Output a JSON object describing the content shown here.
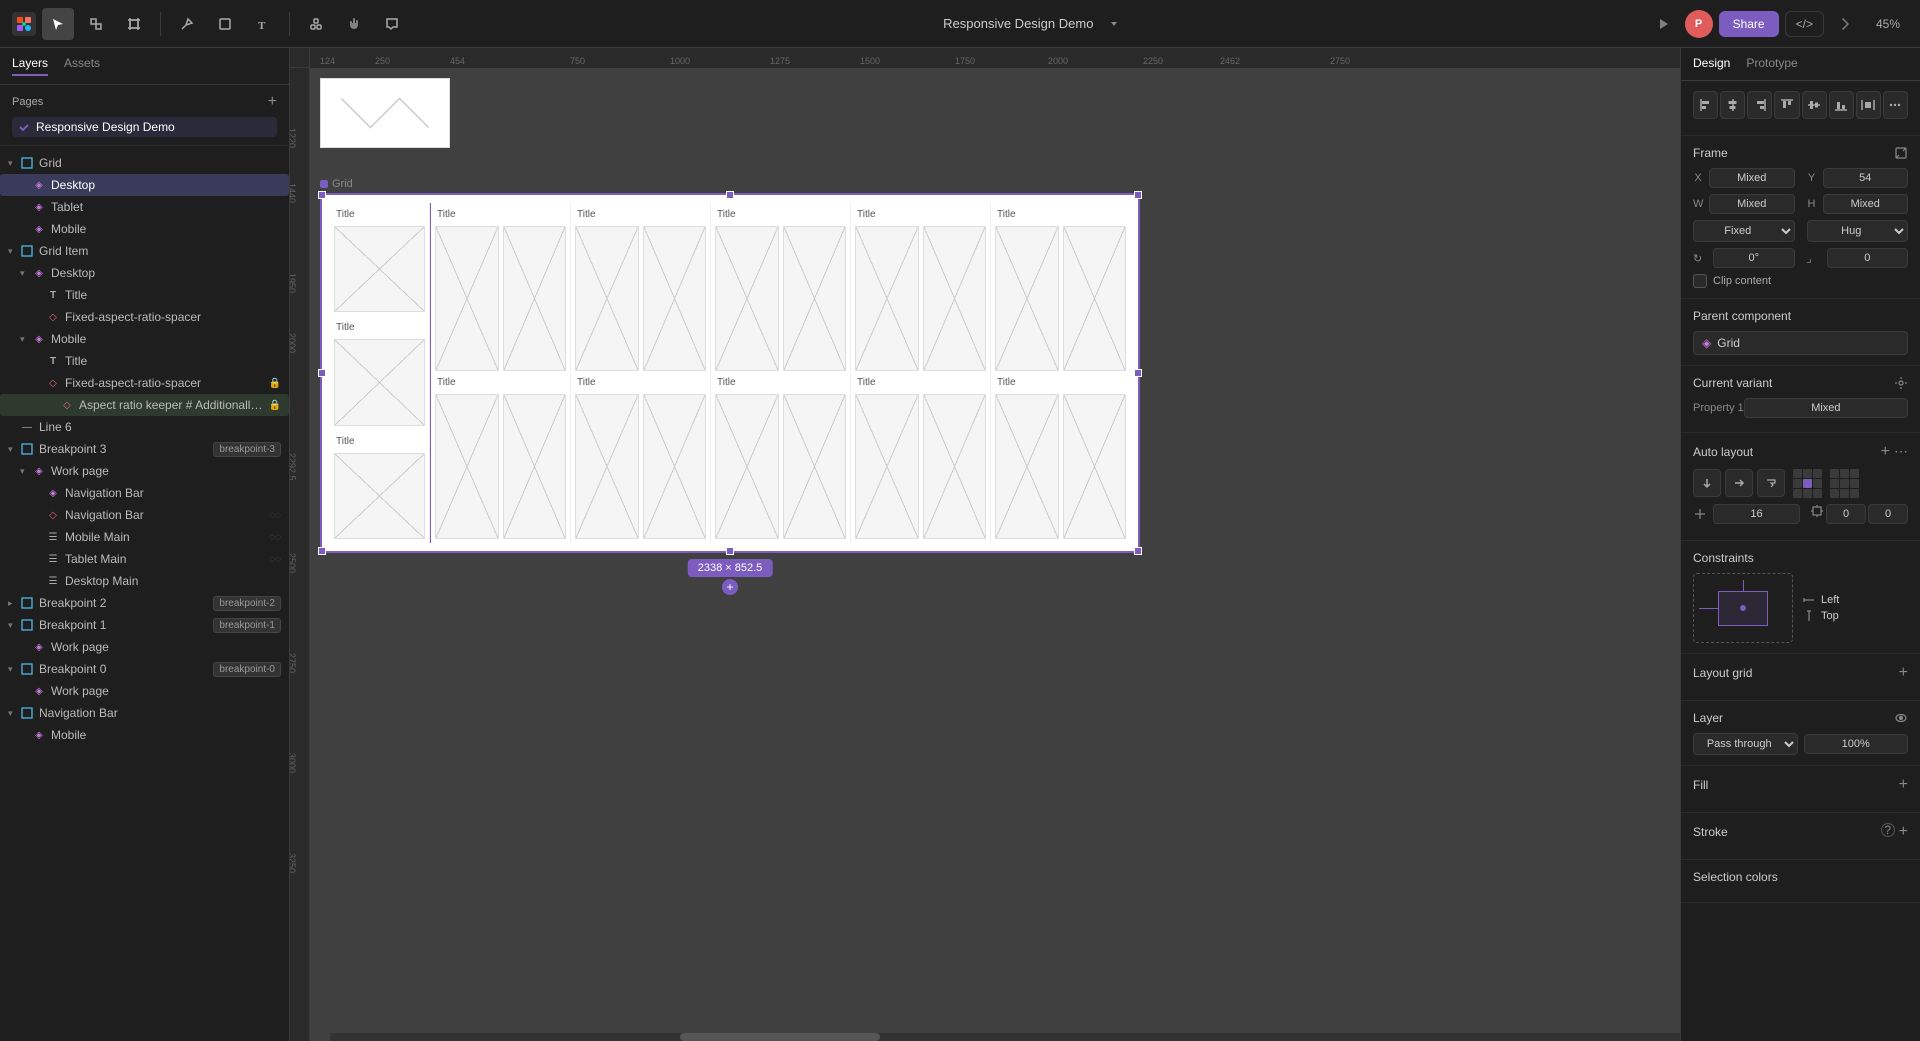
{
  "toolbar": {
    "title": "Responsive Design Demo",
    "share_label": "Share",
    "zoom_label": "45%",
    "code_label": "</>"
  },
  "sidebar": {
    "tabs": [
      {
        "id": "layers",
        "label": "Layers"
      },
      {
        "id": "assets",
        "label": "Assets"
      }
    ],
    "active_tab": "layers",
    "pages": {
      "header": "Pages",
      "items": [
        {
          "id": "responsive",
          "label": "Responsive Design Demo",
          "active": true
        }
      ]
    },
    "layers": [
      {
        "id": "grid",
        "name": "Grid",
        "icon": "frame",
        "indent": 0,
        "expanded": true
      },
      {
        "id": "desktop",
        "name": "Desktop",
        "icon": "component",
        "indent": 1,
        "selected": true
      },
      {
        "id": "tablet",
        "name": "Tablet",
        "icon": "component",
        "indent": 1
      },
      {
        "id": "mobile",
        "name": "Mobile",
        "icon": "component",
        "indent": 1
      },
      {
        "id": "grid-item",
        "name": "Grid Item",
        "icon": "frame",
        "indent": 0,
        "expanded": true
      },
      {
        "id": "desktop-gi",
        "name": "Desktop",
        "icon": "component",
        "indent": 1,
        "expanded": true
      },
      {
        "id": "title-1",
        "name": "Title",
        "icon": "text",
        "indent": 2
      },
      {
        "id": "fixed-aspect-1",
        "name": "Fixed-aspect-ratio-spacer",
        "icon": "shape",
        "indent": 2
      },
      {
        "id": "mobile-gi",
        "name": "Mobile",
        "icon": "component",
        "indent": 1,
        "expanded": true
      },
      {
        "id": "title-2",
        "name": "Title",
        "icon": "text",
        "indent": 2
      },
      {
        "id": "fixed-aspect-2",
        "name": "Fixed-aspect-ratio-spacer",
        "icon": "shape",
        "indent": 2
      },
      {
        "id": "line-6",
        "name": "Line 6",
        "icon": "line",
        "indent": 0
      },
      {
        "id": "breakpoint-3",
        "name": "Breakpoint 3",
        "icon": "frame",
        "indent": 0,
        "badge": "breakpoint-3",
        "expanded": true
      },
      {
        "id": "work-page-1",
        "name": "Work page",
        "icon": "component",
        "indent": 1,
        "expanded": true
      },
      {
        "id": "nav-bar-1",
        "name": "Navigation Bar",
        "icon": "component",
        "indent": 2
      },
      {
        "id": "nav-bar-2",
        "name": "Navigation Bar",
        "icon": "shape",
        "indent": 2,
        "vis_icon": true
      },
      {
        "id": "mobile-main",
        "name": "Mobile Main",
        "icon": "group",
        "indent": 2,
        "vis_icon": true
      },
      {
        "id": "tablet-main",
        "name": "Tablet Main",
        "icon": "group",
        "indent": 2,
        "vis_icon": true
      },
      {
        "id": "desktop-main",
        "name": "Desktop Main",
        "icon": "group",
        "indent": 2
      },
      {
        "id": "breakpoint-2",
        "name": "Breakpoint 2",
        "icon": "frame",
        "indent": 0,
        "badge": "breakpoint-2"
      },
      {
        "id": "breakpoint-1",
        "name": "Breakpoint 1",
        "icon": "frame",
        "indent": 0,
        "badge": "breakpoint-1",
        "expanded": true
      },
      {
        "id": "work-page-2",
        "name": "Work page",
        "icon": "component",
        "indent": 1
      },
      {
        "id": "breakpoint-0",
        "name": "Breakpoint 0",
        "icon": "frame",
        "indent": 0,
        "badge": "breakpoint-0",
        "expanded": true
      },
      {
        "id": "work-page-3",
        "name": "Work page",
        "icon": "component",
        "indent": 1
      },
      {
        "id": "nav-bar-3",
        "name": "Navigation Bar",
        "icon": "frame",
        "indent": 0,
        "expanded": true
      },
      {
        "id": "mobile-nav",
        "name": "Mobile",
        "icon": "component",
        "indent": 1
      }
    ]
  },
  "canvas": {
    "rulers": {
      "h_marks": [
        "124",
        "250",
        "454",
        "750",
        "1000",
        "1275",
        "1500",
        "1750",
        "2000",
        "2250",
        "2462",
        "2750"
      ],
      "v_marks": [
        "1220",
        "1440",
        "1950",
        "2000",
        "2292.5",
        "2500",
        "2750",
        "3000",
        "3250"
      ]
    },
    "grid_frame": {
      "label": "Grid",
      "size_badge": "2338 × 852.5",
      "columns": [
        "Title",
        "Title",
        "Title",
        "Title",
        "Title",
        "Title"
      ]
    }
  },
  "right_panel": {
    "tabs": [
      {
        "id": "design",
        "label": "Design",
        "active": true
      },
      {
        "id": "prototype",
        "label": "Prototype"
      }
    ],
    "frame_section": {
      "title": "Frame",
      "x_label": "X",
      "x_value": "Mixed",
      "y_label": "Y",
      "y_value": "54",
      "w_label": "W",
      "w_value": "Mixed",
      "h_label": "H",
      "h_value": "Mixed",
      "constraint_label_1": "Fixed",
      "constraint_value_1": "Hug",
      "rotation_label": "↻",
      "rotation_value": "0°",
      "corner_label": "⌟",
      "corner_value": "0",
      "clip_content_label": "Clip content"
    },
    "align": {
      "buttons": [
        "align-left",
        "align-center-h",
        "align-right",
        "align-top",
        "align-center-v",
        "align-bottom",
        "distribute-h",
        "more"
      ]
    },
    "parent_component": {
      "title": "Parent component",
      "value": "Grid",
      "icon": "component-icon"
    },
    "current_variant": {
      "title": "Current variant",
      "property_1_label": "Property 1",
      "property_1_value": "Mixed"
    },
    "auto_layout": {
      "title": "Auto layout",
      "spacing_value": "16",
      "padding_h": "0",
      "padding_v": "0"
    },
    "constraints": {
      "title": "Constraints",
      "horizontal": "Left",
      "vertical": "Top"
    },
    "layout_grid": {
      "title": "Layout grid"
    },
    "layer": {
      "title": "Layer",
      "blend_mode": "Pass through",
      "opacity": "100%"
    },
    "fill": {
      "title": "Fill"
    },
    "stroke": {
      "title": "Stroke"
    },
    "selection_colors": {
      "title": "Selection colors"
    }
  },
  "icons": {
    "frame": "⬜",
    "component": "◈",
    "text": "T",
    "shape": "◇",
    "group": "☰",
    "line": "—",
    "section": "▣",
    "chevron_down": "▾",
    "chevron_right": "▸",
    "lock": "🔒",
    "eye_hidden": "◌",
    "plus": "+",
    "settings": "⚙",
    "add": "+",
    "expand": "⊞",
    "collapse": "⊟"
  }
}
